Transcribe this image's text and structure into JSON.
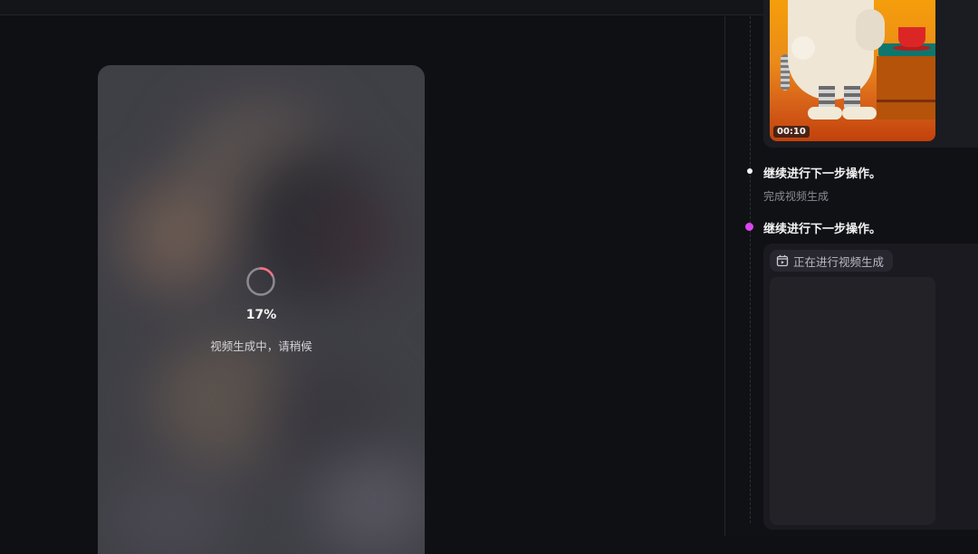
{
  "preview": {
    "progress_percent": "17%",
    "progress_value": 0.17,
    "status": "视频生成中，请稍候"
  },
  "panel": {
    "thumbnail": {
      "duration": "00:10"
    },
    "steps": [
      {
        "title": "继续进行下一步操作。",
        "subtitle": "完成视频生成",
        "dot_color": "#f4f4f5"
      },
      {
        "title": "继续进行下一步操作。",
        "dot_color": "#d946ef"
      }
    ],
    "generating": {
      "badge_label": "正在进行视频生成",
      "icon": "video-clip-icon"
    }
  },
  "colors": {
    "background": "#0f1014",
    "spinner_accent": "#fb7185",
    "active_dot": "#d946ef"
  }
}
